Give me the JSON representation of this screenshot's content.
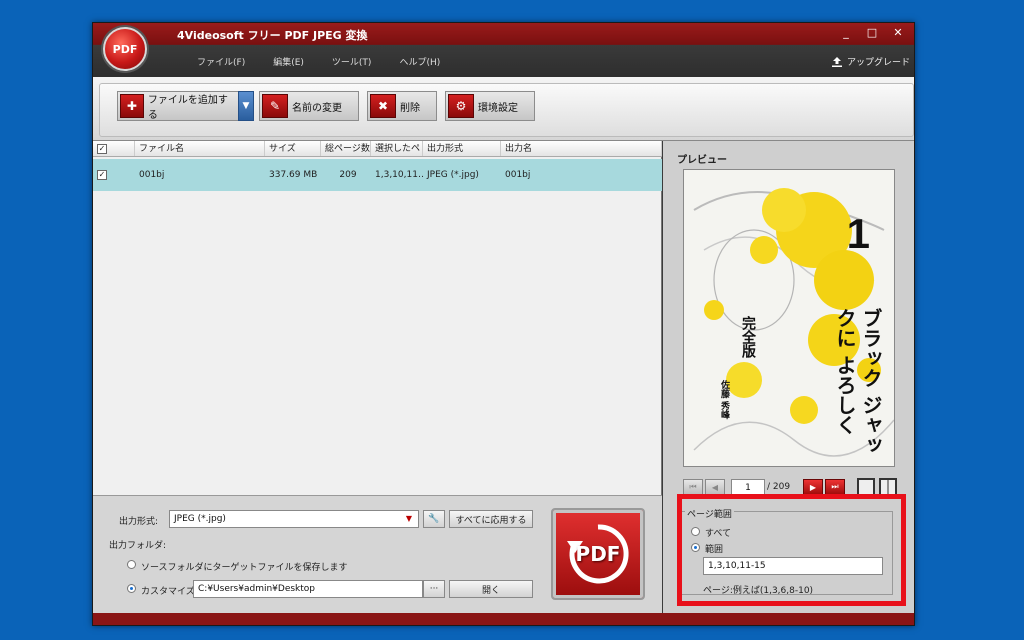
{
  "app": {
    "title": "4Videosoft フリー PDF JPEG 変換",
    "logo_text": "PDF"
  },
  "window_controls": {
    "minimize": "_",
    "maximize": "□",
    "close": "✕"
  },
  "menu": [
    "ファイル(F)",
    "編集(E)",
    "ツール(T)",
    "ヘルプ(H)"
  ],
  "upgrade": {
    "label": "アップグレード",
    "icon": "upload-icon"
  },
  "toolbar": {
    "add_files": "ファイルを追加する",
    "rename": "名前の変更",
    "delete": "削除",
    "settings": "環境設定"
  },
  "table": {
    "columns": [
      "ファイル名",
      "サイズ",
      "総ページ数",
      "選択したペ",
      "出力形式",
      "出力名"
    ],
    "rows": [
      {
        "checked": true,
        "name": "001bj",
        "size": "337.69 MB",
        "pages": "209",
        "selected": "1,3,10,11…",
        "format": "JPEG (*.jpg)",
        "output": "001bj"
      }
    ]
  },
  "preview": {
    "label": "プレビュー",
    "cover_number": "1",
    "cover_title": "ブラック ジャックに よろしく",
    "cover_subtitle": "完全版",
    "cover_author": "佐藤 秀峰",
    "page_current": "1",
    "page_total": "/ 209"
  },
  "output": {
    "format_label": "出力形式:",
    "format_value": "JPEG (*.jpg)",
    "apply_all": "すべてに応用する",
    "folder_label": "出力フォルダ:",
    "source_folder": "ソースフォルダにターゲットファイルを保存します",
    "customize_label": "カスタマイズ:",
    "customize_path": "C:¥Users¥admin¥Desktop",
    "browse": "···",
    "open": "開く"
  },
  "convert_label": "PDF",
  "page_range": {
    "group_label": "ページ範囲",
    "all": "すべて",
    "range": "範囲",
    "range_value": "1,3,10,11-15",
    "example": "ページ:例えば(1,3,6,8-10)"
  },
  "colors": {
    "accent_red": "#e8101a",
    "row_selected": "#a7d9dd",
    "desktop": "#0a63b8"
  }
}
